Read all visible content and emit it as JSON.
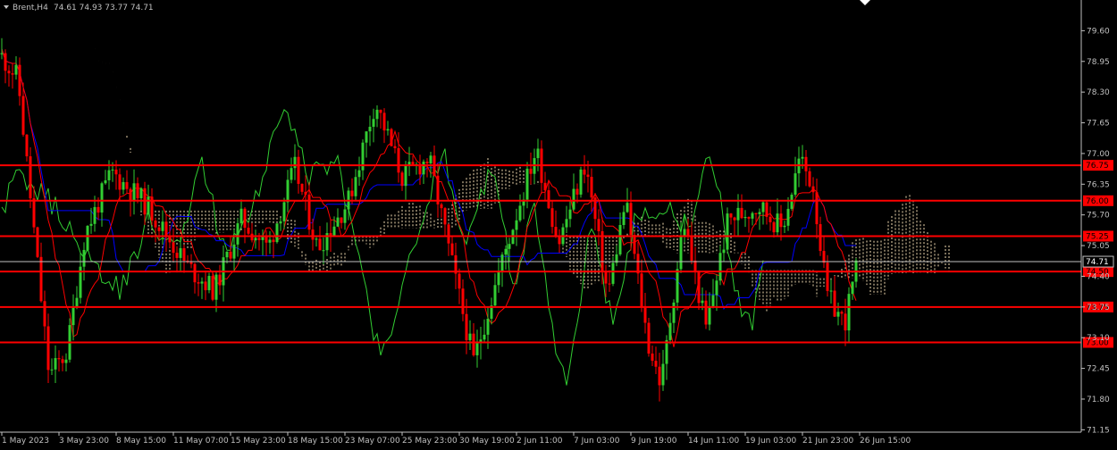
{
  "header": {
    "symbol_label": "Brent,H4",
    "ohlc": "74.61 74.93 73.77 74.71"
  },
  "chart_data": {
    "type": "candlestick",
    "symbol": "Brent",
    "timeframe": "H4",
    "ohlc": {
      "open": 74.61,
      "high": 74.93,
      "low": 73.77,
      "close": 74.71
    },
    "y_ticks": [
      79.6,
      78.95,
      78.3,
      77.65,
      77.0,
      76.35,
      75.7,
      75.05,
      74.4,
      73.75,
      73.1,
      72.45,
      71.8,
      71.15
    ],
    "ylim": [
      71.1,
      80.25
    ],
    "x_labels": [
      "1 May 2023",
      "3 May 23:00",
      "8 May 15:00",
      "11 May 07:00",
      "15 May 23:00",
      "18 May 15:00",
      "23 May 07:00",
      "25 May 23:00",
      "30 May 19:00",
      "2 Jun 11:00",
      "7 Jun 03:00",
      "9 Jun 19:00",
      "14 Jun 11:00",
      "19 Jun 03:00",
      "21 Jun 23:00",
      "26 Jun 15:00"
    ],
    "levels": [
      {
        "value": 76.75,
        "label": "76.75"
      },
      {
        "value": 76.0,
        "label": "76.00"
      },
      {
        "value": 75.25,
        "label": "75.25"
      },
      {
        "value": 74.5,
        "label": "74.50"
      },
      {
        "value": 73.75,
        "label": "73.75"
      },
      {
        "value": 73.0,
        "label": "73.00"
      }
    ],
    "current_price": {
      "value": 74.71,
      "label": "74.71"
    },
    "colors": {
      "background": "#000000",
      "bull": "#32cd32",
      "bear": "#ff0000",
      "level": "#ff0000",
      "kijun": "#0000ff",
      "tenkan": "#ff0000",
      "chikou": "#32cd32",
      "kumo": "#f5deb3",
      "axis_text": "#c0c0c0",
      "price_line": "#c0c0c0"
    }
  }
}
